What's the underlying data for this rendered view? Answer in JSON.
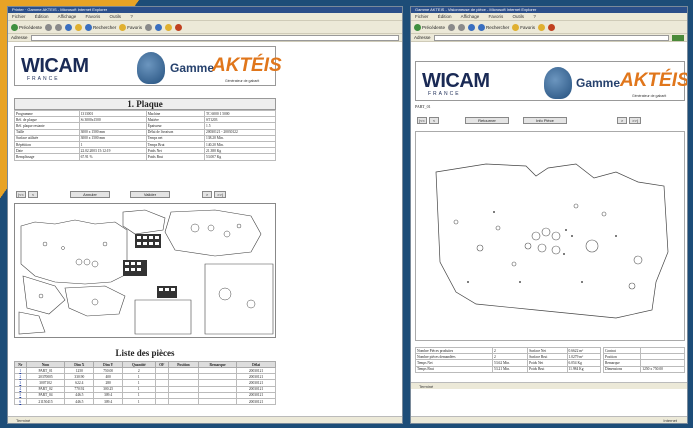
{
  "colors": {
    "accent": "#e8a325",
    "background": "#1d4d78",
    "akteis": "#e0761b"
  },
  "left": {
    "title_bar": "Printer · Gamme AKTEIS - Microsoft Internet Explorer",
    "menu": [
      "Fichier",
      "Édition",
      "Affichage",
      "Favoris",
      "Outils",
      "?"
    ],
    "toolbar": {
      "back": "Précédente",
      "search": "Rechercher",
      "favorites": "Favoris"
    },
    "address_label": "Adresse",
    "banner": {
      "logo": "WICAM",
      "logo_sub": "FRANCE",
      "gamme": "Gamme",
      "brand": "AKTÉIS",
      "tagline": "Générateur de gabarit"
    },
    "section_title": "1. Plaque",
    "plaque_rows": [
      [
        "Programme",
        "1313001",
        "Machine",
        "TC 6000 1 5000"
      ],
      [
        "Réf. de plaque",
        "St 3000x1500",
        "Matière",
        "ST1203"
      ],
      [
        "Réf. plaque restante",
        "",
        "Épaisseur",
        "1.5"
      ],
      [
        "Taille",
        "3000 x 1500 mm",
        "Délai de livraison",
        "20030121 - 20030122"
      ],
      [
        "Surface utilisée",
        "3000 x 1500 mm",
        "Temps net",
        "138.20   Min."
      ],
      [
        "Répétition",
        "1",
        "Temps  Brut",
        "140.20   Min."
      ],
      [
        "Date",
        "22.02.2003   15:12:19",
        "Poids  Net",
        "21.380   Kg"
      ],
      [
        "Remplissage",
        "67.91   %",
        "Poids  Brut",
        "53.007   Kg"
      ]
    ],
    "buttons": {
      "first": "|<<",
      "prev": "<",
      "cancel": "Annuler",
      "validate": "Valider",
      "next": ">",
      "last": ">>|"
    },
    "parts_title": "Liste des pièces",
    "parts_headers": [
      "Nr",
      "Nom",
      "Dim X",
      "Dim Y",
      "Quantité",
      "OF",
      "Position",
      "Remarque",
      "Délai"
    ],
    "parts_rows": [
      [
        "1",
        "PART_01",
        "1250",
        "750.00",
        "2",
        "",
        "",
        "",
        "20030121"
      ],
      [
        "2",
        "20370005",
        "330.90",
        "400",
        "1",
        "",
        "",
        "",
        "20030121"
      ],
      [
        "3",
        "3007102",
        "622.4",
        "280",
        "1",
        "",
        "",
        "",
        "20030121"
      ],
      [
        "4",
        "PART_02",
        "770.92",
        "300.25",
        "1",
        "",
        "",
        "",
        "20030121"
      ],
      [
        "5",
        "PART_04",
        "446.5",
        "309.4",
        "1",
        "",
        "",
        "",
        "20030121"
      ],
      [
        "6",
        "21150415",
        "446.5",
        "309.4",
        "1",
        "",
        "",
        "",
        "20030121"
      ]
    ],
    "status": "Terminé"
  },
  "right": {
    "title_bar": "Gamme AKTEIS - Visionneuse de pièce - Microsoft Internet Explorer",
    "menu": [
      "Fichier",
      "Édition",
      "Affichage",
      "Favoris",
      "Outils",
      "?"
    ],
    "toolbar": {
      "back": "Précédente",
      "search": "Rechercher",
      "favorites": "Favoris"
    },
    "address_label": "Adresse",
    "banner": {
      "logo": "WICAM",
      "logo_sub": "FRANCE",
      "gamme": "Gamme",
      "brand": "AKTÉIS",
      "tagline": "Générateur de gabarit"
    },
    "part_name": "PART_01",
    "buttons": {
      "first": "|<<",
      "prev": "<",
      "back": "Retourner",
      "info": "Info Pièce",
      "next": ">",
      "last": ">>|"
    },
    "info_rows": [
      [
        "Nombre Pièces produites",
        "2",
        "Surface  Net",
        "0.6622  m²"
      ],
      [
        "Nombre pièces demandées",
        "2",
        "Surface  Brut",
        "1.0279  m²"
      ],
      [
        "Temps  Net",
        "53.62  Min.",
        "Poids  Net",
        "6.054  Kg"
      ],
      [
        "Temps  Brut",
        "53.21  Min.",
        "Poids  Brut",
        "11.984  Kg"
      ]
    ],
    "client_rows": [
      [
        "Contrat",
        ""
      ],
      [
        "Position",
        ""
      ],
      [
        "Remarque",
        ""
      ],
      [
        "Dimensions",
        "1250 x 750.00"
      ]
    ],
    "status": "Terminé",
    "zone": "Internet"
  }
}
